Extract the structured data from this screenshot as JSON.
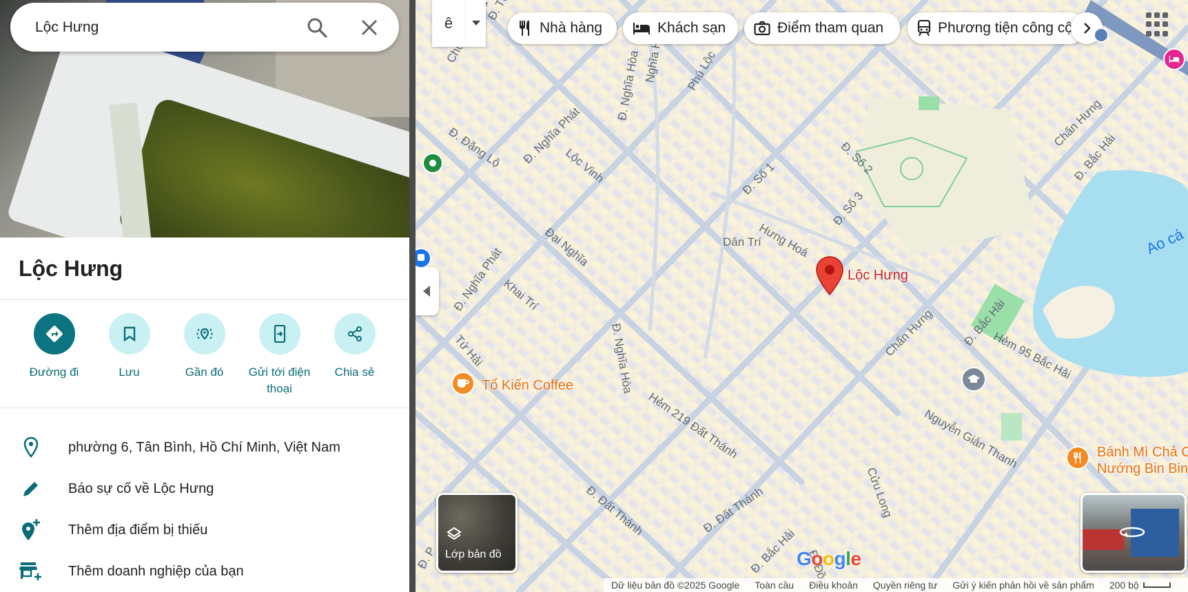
{
  "search": {
    "value": "Lộc Hưng"
  },
  "place": {
    "title": "Lộc Hưng",
    "actions": [
      {
        "label": "Đường đi",
        "icon": "directions-icon"
      },
      {
        "label": "Lưu",
        "icon": "bookmark-icon"
      },
      {
        "label": "Gần đó",
        "icon": "nearby-icon"
      },
      {
        "label": "Gửi tới điện thoại",
        "icon": "send-to-phone-icon"
      },
      {
        "label": "Chia sẻ",
        "icon": "share-icon"
      }
    ],
    "info": [
      {
        "text": "phường 6, Tân Bình, Hồ Chí Minh, Việt Nam",
        "icon": "location-pin-icon"
      },
      {
        "text": "Báo sự cố về Lộc Hưng",
        "icon": "pencil-icon"
      },
      {
        "text": "Thêm địa điểm bị thiếu",
        "icon": "add-location-icon"
      },
      {
        "text": "Thêm doanh nghiệp của bạn",
        "icon": "add-business-icon"
      }
    ]
  },
  "map": {
    "ime_char": "ê",
    "chips": [
      {
        "label": "Nhà hàng",
        "icon": "restaurant-icon"
      },
      {
        "label": "Khách sạn",
        "icon": "hotel-icon"
      },
      {
        "label": "Điểm tham quan",
        "icon": "camera-icon"
      },
      {
        "label": "Phương tiện công cộng",
        "icon": "transit-icon"
      }
    ],
    "pin_label": "Lộc Hưng",
    "pois": [
      {
        "label": "Tổ Kiến Coffee"
      },
      {
        "label": "Bánh Mì Chả C"
      },
      {
        "label": "Nướng Bin Bin"
      }
    ],
    "streets": [
      "Chử Đồng Tử",
      "Đ. Đặng Lộ",
      "Đ. Nghĩa Phát",
      "Lộc Vinh",
      "Đ. Nghĩa Hòa",
      "Nghĩa Hưng",
      "Phú Lộc",
      "Đ. Số 1",
      "Đ. Số 2",
      "Đ. Số 3",
      "Hưng Hoá",
      "Dân Trí",
      "Đại Nghĩa",
      "Đ. Nghĩa Phát",
      "Khai Trí",
      "Đ. Nghĩa Hòa",
      "Tứ Hải",
      "Chấn Hưng",
      "Đ. Bắc Hải",
      "Hẻm 95 Bắc Hải",
      "Hẻm 219 Đất Thánh",
      "Nguyễn Giản Thanh",
      "Cửu Long",
      "Đ. Đất Thánh",
      "Đ. Đất Thánh",
      "Đ. Bắc Hải",
      "Đ. Đồng",
      "Chấn Hưng",
      "Đ. Bắc Hải",
      "Ao cá",
      "Đ. Tủ",
      "Đ. P"
    ],
    "layers_label": "Lớp bản đồ",
    "logo": "Google",
    "footer": {
      "data": "Dữ liệu bản đồ ©2025 Google",
      "global": "Toàn cầu",
      "terms": "Điều khoản",
      "privacy": "Quyền riêng tư",
      "feedback": "Gửi ý kiến phản hồi về sản phẩm",
      "scale": "200 bộ"
    }
  },
  "colors": {
    "accent": "#0b7480",
    "action_bg": "#c9f1f3",
    "pin": "#ea4335",
    "poi_orange": "#f28b24"
  }
}
